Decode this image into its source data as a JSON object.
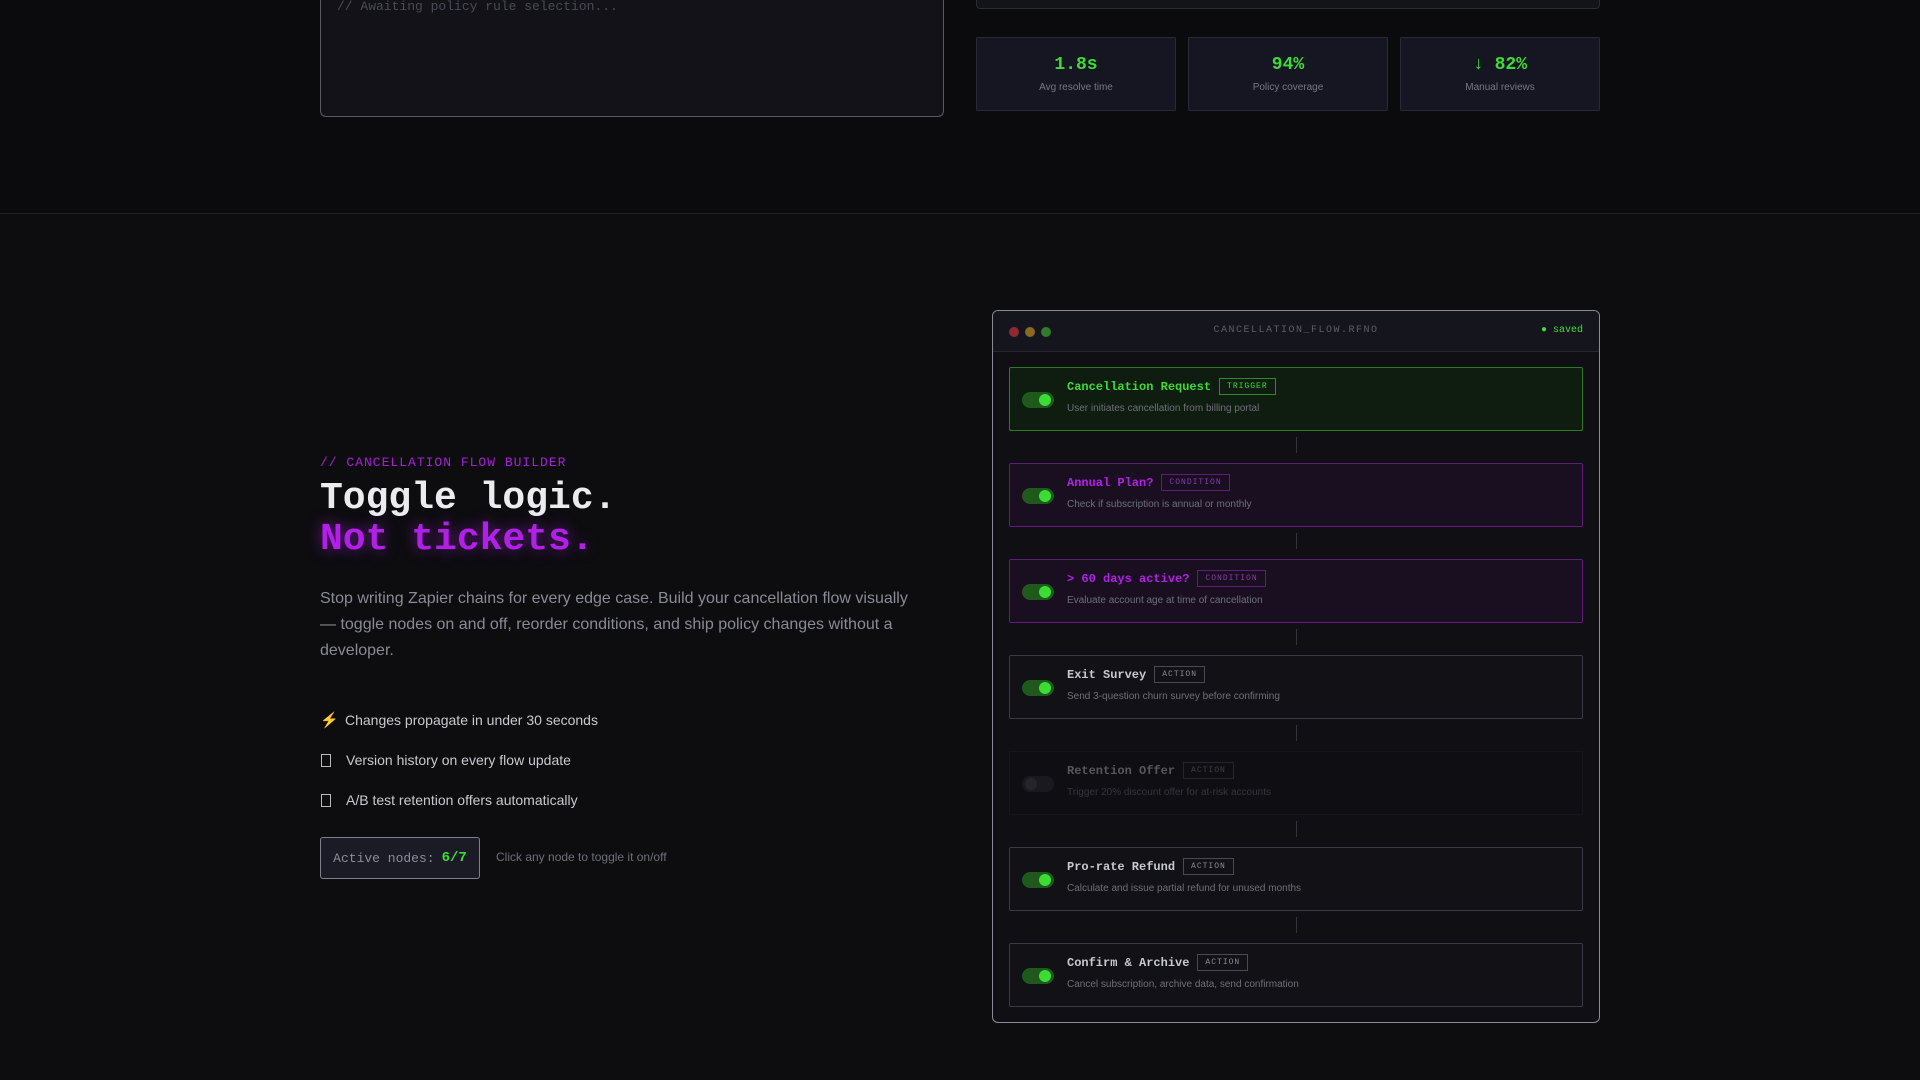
{
  "top": {
    "console_line": "// Awaiting policy rule selection...",
    "stats": [
      {
        "value": "1.8s",
        "label": "Avg resolve time"
      },
      {
        "value": "94%",
        "label": "Policy coverage"
      },
      {
        "value": "↓ 82%",
        "label": "Manual reviews"
      }
    ]
  },
  "hero": {
    "eyebrow": "// CANCELLATION FLOW BUILDER",
    "headline_line1": "Toggle logic.",
    "headline_line2": "Not tickets.",
    "lede": "Stop writing Zapier chains for every edge case. Build your cancellation flow visually — toggle nodes on and off, reorder conditions, and ship policy changes without a developer.",
    "features": [
      {
        "icon": "lightning-icon",
        "glyph": "⚡",
        "text": "Changes propagate in under 30 seconds"
      },
      {
        "icon": "square-icon",
        "glyph": "",
        "text": "Version history on every flow update"
      },
      {
        "icon": "square-icon",
        "glyph": "",
        "text": "A/B test retention offers automatically"
      }
    ],
    "active_label": "Active nodes:",
    "active_count": "6/7",
    "hint": "Click any node to toggle it on/off"
  },
  "flow": {
    "title": "CANCELLATION_FLOW.RFNO",
    "status": "● saved",
    "colors": {
      "green": "#3ddc35",
      "purple": "#b21fe8"
    },
    "nodes": [
      {
        "title": "Cancellation Request",
        "badge": "TRIGGER",
        "desc": "User initiates cancellation from billing portal",
        "kind": "trigger",
        "on": true
      },
      {
        "title": "Annual Plan?",
        "badge": "CONDITION",
        "desc": "Check if subscription is annual or monthly",
        "kind": "condition",
        "on": true
      },
      {
        "title": "> 60 days active?",
        "badge": "CONDITION",
        "desc": "Evaluate account age at time of cancellation",
        "kind": "condition",
        "on": true
      },
      {
        "title": "Exit Survey",
        "badge": "ACTION",
        "desc": "Send 3-question churn survey before confirming",
        "kind": "action",
        "on": true
      },
      {
        "title": "Retention Offer",
        "badge": "ACTION",
        "desc": "Trigger 20% discount offer for at-risk accounts",
        "kind": "action",
        "on": false
      },
      {
        "title": "Pro-rate Refund",
        "badge": "ACTION",
        "desc": "Calculate and issue partial refund for unused months",
        "kind": "action",
        "on": true
      },
      {
        "title": "Confirm & Archive",
        "badge": "ACTION",
        "desc": "Cancel subscription, archive data, send confirmation",
        "kind": "action",
        "on": true
      }
    ]
  }
}
